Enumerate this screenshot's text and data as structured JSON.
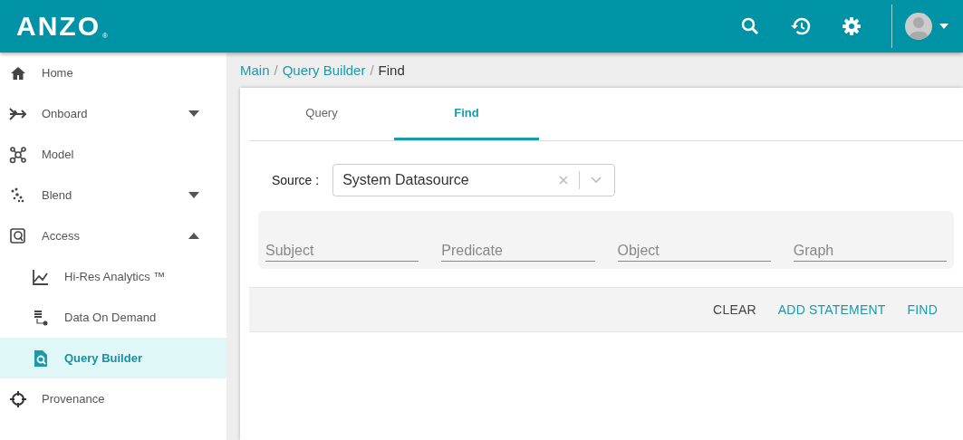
{
  "header": {
    "logo": "ANZO",
    "logo_mark": "®"
  },
  "sidebar": {
    "items": [
      {
        "label": "Home",
        "selected": false
      },
      {
        "label": "Onboard",
        "expanded": false,
        "selected": false
      },
      {
        "label": "Model",
        "selected": false
      },
      {
        "label": "Blend",
        "expanded": false,
        "selected": false
      },
      {
        "label": "Access",
        "expanded": true,
        "selected": false,
        "children": [
          {
            "label": "Hi-Res Analytics ™",
            "selected": false
          },
          {
            "label": "Data On Demand",
            "selected": false
          },
          {
            "label": "Query Builder",
            "selected": true
          }
        ]
      },
      {
        "label": "Provenance",
        "selected": false
      }
    ]
  },
  "breadcrumb": [
    {
      "kind": "link",
      "text": "Main"
    },
    {
      "kind": "separator",
      "text": "/"
    },
    {
      "kind": "link",
      "text": "Query Builder"
    },
    {
      "kind": "separator",
      "text": "/"
    },
    {
      "kind": "current",
      "text": "Find"
    }
  ],
  "tabs": [
    {
      "label": "Query",
      "selected": false
    },
    {
      "label": "Find",
      "selected": true
    }
  ],
  "source": {
    "label": "Source :",
    "value": "System Datasource"
  },
  "statement_fields": [
    {
      "placeholder": "Subject"
    },
    {
      "placeholder": "Predicate"
    },
    {
      "placeholder": "Object"
    },
    {
      "placeholder": "Graph"
    }
  ],
  "actions": [
    {
      "label": "CLEAR",
      "primary": false
    },
    {
      "label": "ADD STATEMENT",
      "primary": true
    },
    {
      "label": "FIND",
      "primary": true
    }
  ]
}
